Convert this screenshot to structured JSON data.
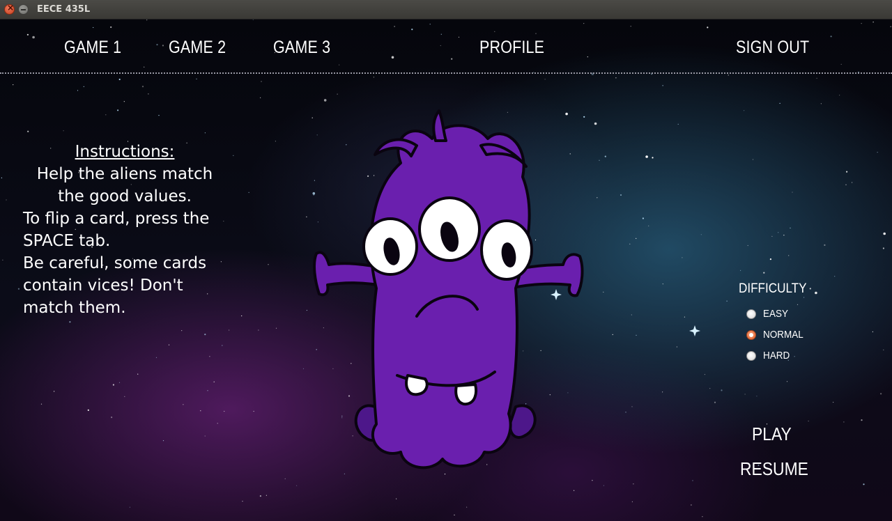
{
  "window": {
    "title": "EECE 435L",
    "controls": [
      "close-icon",
      "minimize-icon"
    ]
  },
  "nav": {
    "game1": "GAME 1",
    "game2": "GAME 2",
    "game3": "GAME 3",
    "profile": "PROFILE",
    "sign_out": "SIGN OUT"
  },
  "instructions": {
    "heading": "Instructions:",
    "lines": [
      "Help the aliens match",
      "the good values.",
      "To flip a card, press the",
      "SPACE tab.",
      "Be careful, some cards",
      "contain vices! Don't",
      "match them."
    ]
  },
  "difficulty": {
    "label": "DIFFICULTY",
    "options": [
      {
        "label": "EASY",
        "selected": false
      },
      {
        "label": "NORMAL",
        "selected": true
      },
      {
        "label": "HARD",
        "selected": false
      }
    ]
  },
  "actions": {
    "play": "PLAY",
    "resume": "RESUME"
  },
  "colors": {
    "alien_body": "#6a1fae",
    "radio_selected": "#dd5a25",
    "text": "#ffffff"
  }
}
